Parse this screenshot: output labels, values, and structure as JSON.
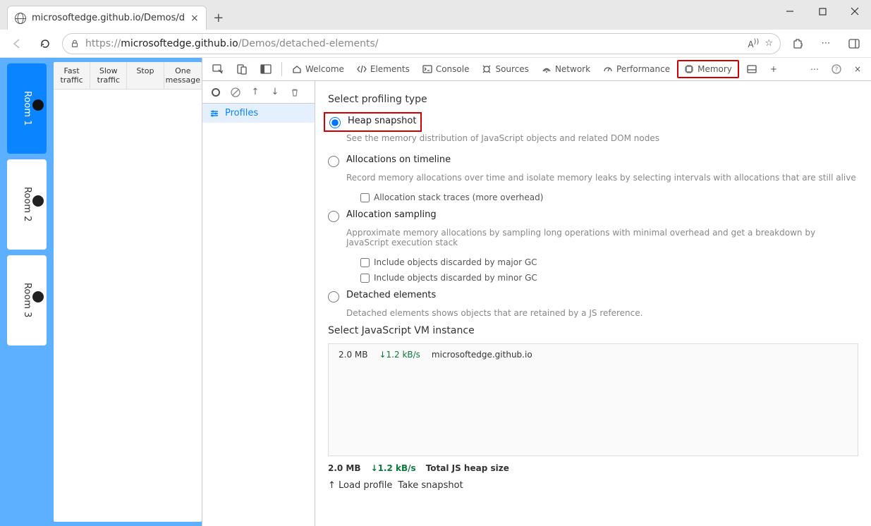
{
  "browser": {
    "tab_title": "microsoftedge.github.io/Demos/d",
    "url_prefix": "https://",
    "url_host": "microsoftedge.github.io",
    "url_path": "/Demos/detached-elements/"
  },
  "app": {
    "rooms": [
      "Room 1",
      "Room 2",
      "Room 3"
    ],
    "buttons": {
      "fast": "Fast traffic",
      "slow": "Slow traffic",
      "stop": "Stop",
      "one": "One message"
    }
  },
  "devtools": {
    "tabs": {
      "welcome": "Welcome",
      "elements": "Elements",
      "console": "Console",
      "sources": "Sources",
      "network": "Network",
      "performance": "Performance",
      "memory": "Memory"
    },
    "sidebar": {
      "profiles": "Profiles"
    },
    "memory": {
      "heading1": "Select profiling type",
      "heap": {
        "label": "Heap snapshot",
        "desc": "See the memory distribution of JavaScript objects and related DOM nodes"
      },
      "timeline": {
        "label": "Allocations on timeline",
        "desc": "Record memory allocations over time and isolate memory leaks by selecting intervals with allocations that are still alive",
        "sub": "Allocation stack traces (more overhead)"
      },
      "sampling": {
        "label": "Allocation sampling",
        "desc": "Approximate memory allocations by sampling long operations with minimal overhead and get a breakdown by JavaScript execution stack",
        "sub1": "Include objects discarded by major GC",
        "sub2": "Include objects discarded by minor GC"
      },
      "detached": {
        "label": "Detached elements",
        "desc": "Detached elements shows objects that are retained by a JS reference."
      },
      "heading2": "Select JavaScript VM instance",
      "vm": {
        "size": "2.0 MB",
        "rate": "↓1.2 kB/s",
        "host": "microsoftedge.github.io"
      },
      "footer": {
        "size": "2.0 MB",
        "rate": "↓1.2 kB/s",
        "label": "Total JS heap size",
        "load": "Load profile",
        "take": "Take snapshot"
      }
    }
  }
}
